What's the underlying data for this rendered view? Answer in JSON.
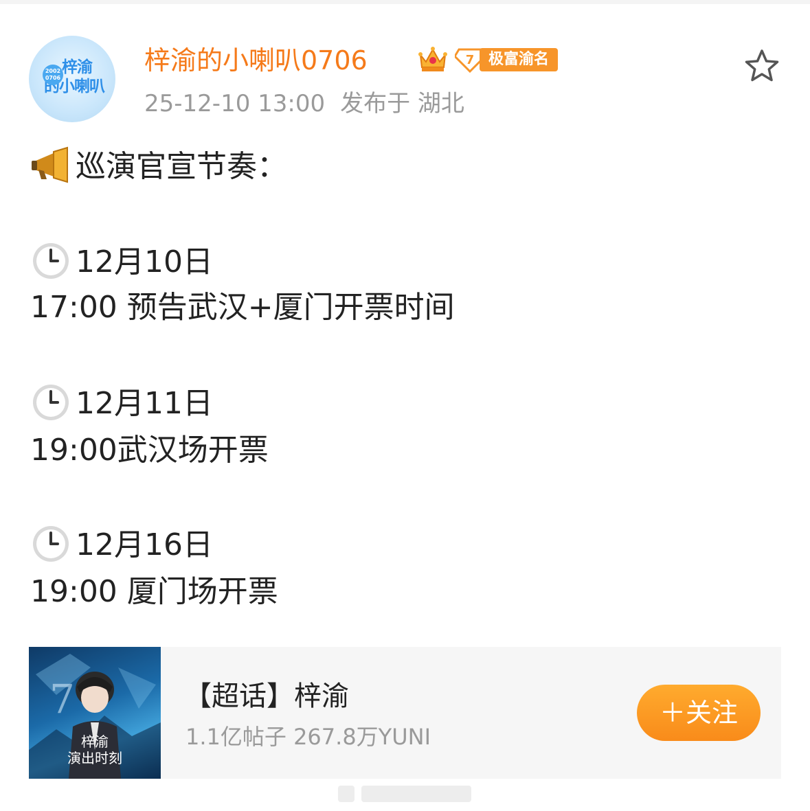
{
  "user": {
    "avatar_text_line1": "梓渝",
    "avatar_text_line2": "的小喇叭",
    "avatar_year": "2002 0706",
    "name": "梓渝的小喇叭0706",
    "level": "7",
    "badge_label": "极富渝名"
  },
  "post": {
    "timestamp": "25-12-10 13:00",
    "location": "发布于 湖北",
    "heading": "巡演官宣节奏：",
    "schedule": [
      {
        "date": "12月10日",
        "detail": "17:00 预告武汉+厦门开票时间"
      },
      {
        "date": "12月11日",
        "detail": "19:00武汉场开票"
      },
      {
        "date": "12月16日",
        "detail": "19:00 厦门场开票"
      }
    ]
  },
  "topic_card": {
    "title": "【超话】梓渝",
    "stats": "1.1亿帖子 267.8万YUNI",
    "thumbnail_caption_line1": "梓渝",
    "thumbnail_caption_line2": "演出时刻",
    "follow_label": "＋关注"
  },
  "icons": {
    "megaphone": "megaphone-icon",
    "clock": "clock-icon",
    "star": "star-icon",
    "crown": "crown-icon"
  },
  "colors": {
    "username": "#f57a1a",
    "badge": "#f7952a",
    "meta_text": "#9a9a9a",
    "follow_button": "#f98b1a",
    "card_bg": "#f6f6f6"
  }
}
